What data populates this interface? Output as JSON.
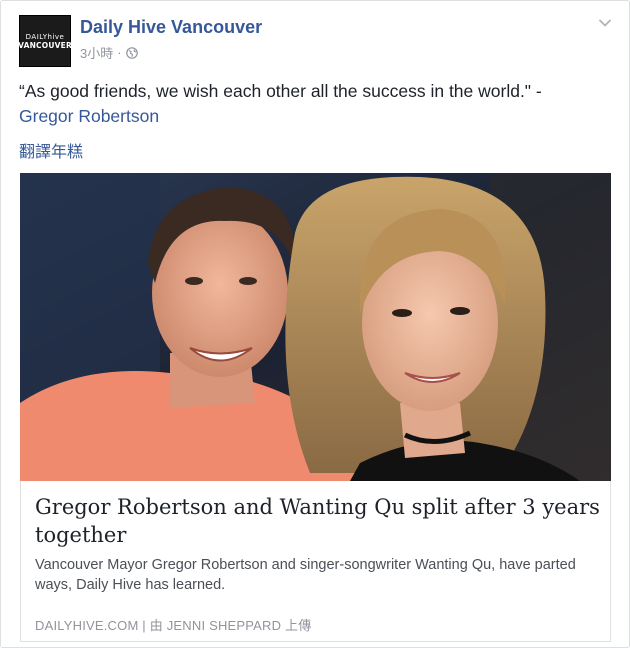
{
  "post": {
    "page_name": "Daily Hive Vancouver",
    "avatar": {
      "line1": "DAILYhive",
      "line2": "VANCOUVER"
    },
    "timestamp": "3小時",
    "separator": "·",
    "privacy_icon": "globe-icon",
    "menu_icon": "chevron-down-icon",
    "text_quote": "“As good friends, we wish each other all the success in the world.\" -",
    "text_author": "Gregor Robertson",
    "translate_label": "翻譯年糕"
  },
  "link_preview": {
    "image_alt": "Selfie photo",
    "title": "Gregor Robertson and Wanting Qu split after 3 years together",
    "description": "Vancouver Mayor Gregor Robertson and singer-songwriter Wanting Qu, have parted ways, Daily Hive has learned.",
    "source": "DAILYHIVE.COM | 由 JENNI SHEPPARD 上傳"
  },
  "colors": {
    "link_blue": "#365899",
    "text": "#1d2129",
    "meta_gray": "#90949c",
    "border": "#dddfe2"
  }
}
